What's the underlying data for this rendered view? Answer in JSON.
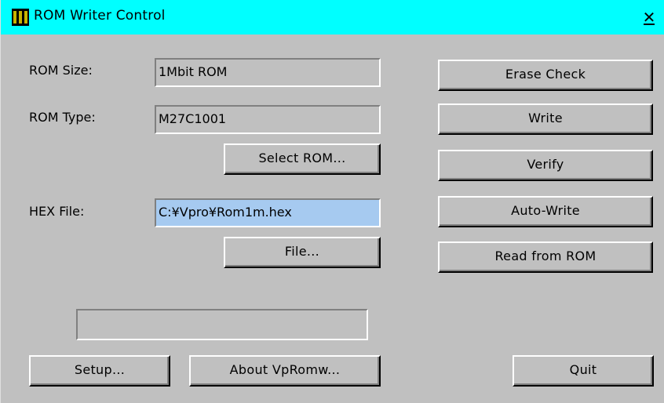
{
  "window": {
    "title": "ROM Writer Control",
    "title_bar_color": "#00ffff",
    "close_label": "✕"
  },
  "rom_size": {
    "label": "ROM Size:",
    "value": "1Mbit ROM"
  },
  "rom_type": {
    "label": "ROM Type:",
    "value": "M27C1001"
  },
  "select_rom_button": "Select ROM...",
  "hex_file": {
    "label": "HEX File:",
    "value": "C:¥Vpro¥Rom1m.hex",
    "highlight_color": "#a6caf0"
  },
  "file_button": "File...",
  "status_field": "",
  "actions": {
    "erase_check": "Erase Check",
    "write": "Write",
    "verify": "Verify",
    "auto_write": "Auto-Write",
    "read_from_rom": "Read from ROM"
  },
  "footer": {
    "setup": "Setup...",
    "about": "About VpRomw...",
    "quit": "Quit"
  }
}
